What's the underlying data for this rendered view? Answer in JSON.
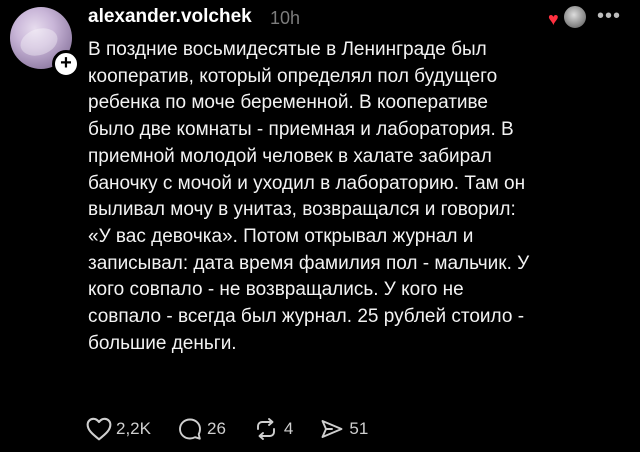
{
  "post": {
    "username": "alexander.volchek",
    "time": "10h",
    "text_lines": [
      "В поздние восьмидесятые в Ленинграде был",
      "кооператив, который определял пол будущего",
      "ребенка по моче беременной. В кооперативе",
      "было две комнаты - приемная и лаборатория. В",
      "приемной молодой человек в халате забирал",
      "баночку с мочой и уходил в лабораторию. Там он",
      "выливал мочу в унитаз, возвращался и говорил:",
      "«У вас девочка». Потом открывал журнал и",
      "записывал: дата время фамилия пол - мальчик. У",
      "кого совпало - не возвращались. У кого не",
      "совпало - всегда был журнал. 25 рублей стоило -",
      "большие деньги."
    ]
  },
  "actions": {
    "likes": "2,2K",
    "comments": "26",
    "reposts": "4",
    "shares": "51"
  },
  "icons": {
    "avatar": "avatar",
    "follow": "plus-icon",
    "liked_by": "heart-icon",
    "more": "more-icon",
    "like": "heart-outline-icon",
    "comment": "comment-icon",
    "repost": "repost-icon",
    "share": "send-icon"
  },
  "colors": {
    "background": "#000000",
    "text": "#f3f3f3",
    "muted": "#7c7c7c",
    "heart": "#ff3040"
  }
}
